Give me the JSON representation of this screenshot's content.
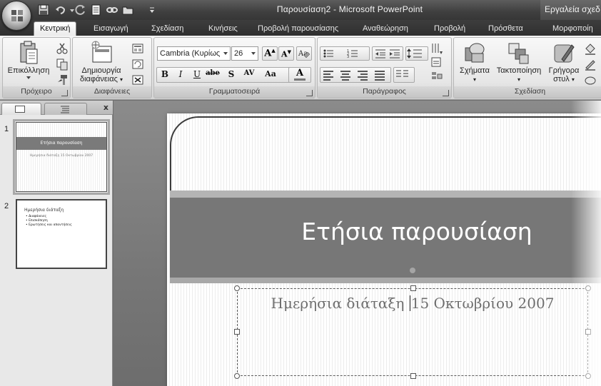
{
  "window": {
    "title": "Παρουσίαση2 - Microsoft PowerPoint",
    "contextual_tab_title": "Εργαλεία σχεδ"
  },
  "tabs": [
    {
      "label": "Κεντρική",
      "active": true
    },
    {
      "label": "Εισαγωγή"
    },
    {
      "label": "Σχεδίαση"
    },
    {
      "label": "Κινήσεις"
    },
    {
      "label": "Προβολή παρουσίασης"
    },
    {
      "label": "Αναθεώρηση"
    },
    {
      "label": "Προβολή"
    },
    {
      "label": "Πρόσθετα"
    },
    {
      "label": "Μορφοποίη"
    }
  ],
  "ribbon": {
    "clipboard": {
      "group_label": "Πρόχειρο",
      "paste_label": "Επικόλληση"
    },
    "slides": {
      "group_label": "Διαφάνειες",
      "new_slide_line1": "Δημιουργία",
      "new_slide_line2": "διαφάνειας"
    },
    "font": {
      "group_label": "Γραμματοσειρά",
      "font_name": "Cambria (Κυρίως",
      "font_size": "26"
    },
    "paragraph": {
      "group_label": "Παράγραφος"
    },
    "drawing": {
      "group_label": "Σχεδίαση",
      "shapes_label": "Σχήματα",
      "arrange_label": "Τακτοποίηση",
      "quick_styles_line1": "Γρήγορα",
      "quick_styles_line2": "στυλ"
    }
  },
  "pane": {
    "close_label": "x",
    "slides": [
      {
        "number": "1",
        "title": "Ετήσια παρουσίαση",
        "subtitle": "Ημερήσια διάταξη 15 Οκτωβρίου 2007"
      },
      {
        "number": "2",
        "title": "Ημερήσια διάταξη",
        "bullets": [
          "Διαφάνειες",
          "Επισκόπηση",
          "Ερωτήσεις και απαντήσεις"
        ]
      }
    ]
  },
  "slide": {
    "title": "Ετήσια παρουσίαση",
    "subtitle_before_caret": "Ημερήσια διάταξη ",
    "subtitle_after_caret": "15 Οκτωβρίου 2007"
  }
}
